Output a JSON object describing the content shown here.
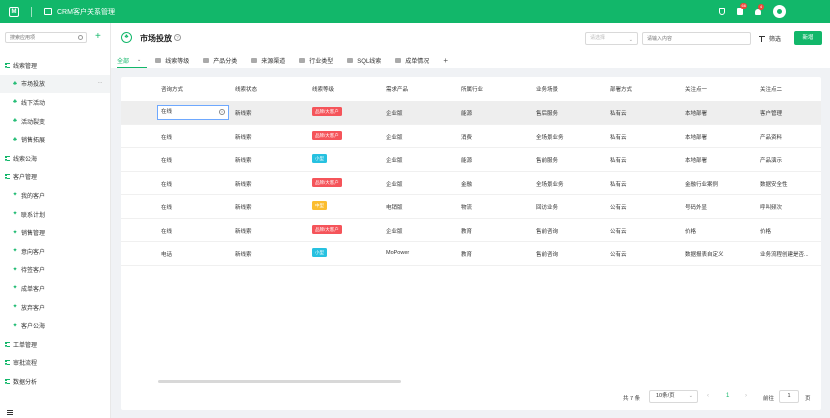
{
  "header": {
    "app_title": "CRM客户关系管理",
    "notif_doc_badge": "66",
    "notif_bell_badge": "4"
  },
  "sidebar": {
    "search_placeholder": "搜索应用项",
    "add_symbol": "+",
    "groups": [
      {
        "label": "线索管理",
        "type": "group"
      },
      {
        "label": "市场投放",
        "type": "child",
        "active": true
      },
      {
        "label": "线下活动",
        "type": "child"
      },
      {
        "label": "活动裂变",
        "type": "child"
      },
      {
        "label": "销售拓展",
        "type": "child"
      },
      {
        "label": "线索公海",
        "type": "group"
      },
      {
        "label": "客户管理",
        "type": "group"
      },
      {
        "label": "我的客户",
        "type": "child"
      },
      {
        "label": "联系计划",
        "type": "child"
      },
      {
        "label": "销售管理",
        "type": "child"
      },
      {
        "label": "意向客户",
        "type": "child"
      },
      {
        "label": "待签客户",
        "type": "child"
      },
      {
        "label": "成单客户",
        "type": "child"
      },
      {
        "label": "放弃客户",
        "type": "child"
      },
      {
        "label": "客户公海",
        "type": "child"
      },
      {
        "label": "工单管理",
        "type": "group"
      },
      {
        "label": "审批流程",
        "type": "group"
      },
      {
        "label": "数据分析",
        "type": "group"
      }
    ]
  },
  "page": {
    "title": "市场投放",
    "select_placeholder": "请选择",
    "keyword_placeholder": "请输入内容",
    "filter_label": "筛选",
    "new_button": "新增",
    "tabs": [
      "全部",
      "线索等级",
      "产品分类",
      "来源渠道",
      "行业类型",
      "SQL线索",
      "成单情况"
    ],
    "tab_add": "+"
  },
  "table": {
    "columns": [
      "咨询方式",
      "线索状态",
      "线索等级",
      "需求产品",
      "所属行业",
      "业务场景",
      "部署方式",
      "关注点一",
      "关注点二"
    ],
    "rows": [
      [
        "在线",
        "新线索",
        "品牌/大客户",
        "企业版",
        "能源",
        "售后服务",
        "私有云",
        "本地部署",
        "客户管理"
      ],
      [
        "在线",
        "新线索",
        "品牌/大客户",
        "企业版",
        "消费",
        "全场景业务",
        "私有云",
        "本地部署",
        "产品资料"
      ],
      [
        "在线",
        "新线索",
        "小型",
        "企业版",
        "能源",
        "售前服务",
        "私有云",
        "本地部署",
        "产品演示"
      ],
      [
        "在线",
        "新线索",
        "品牌/大客户",
        "企业版",
        "金融",
        "全场景业务",
        "私有云",
        "金融行业案例",
        "数据安全性"
      ],
      [
        "在线",
        "新线索",
        "中型",
        "电销版",
        "物流",
        "回访业务",
        "公有云",
        "号码外显",
        "呼叫频次"
      ],
      [
        "在线",
        "新线索",
        "品牌/大客户",
        "企业版",
        "教育",
        "售前咨询",
        "公有云",
        "价格",
        "价格"
      ],
      [
        "电话",
        "新线索",
        "小型",
        "MoPower",
        "教育",
        "售前咨询",
        "公有云",
        "数据报表自定义",
        "业务流程创建是否..."
      ]
    ],
    "tag_colors": {
      "品牌/大客户": "#f5545a",
      "小型": "#27c1e0",
      "中型": "#fbbd30"
    }
  },
  "pager": {
    "total": "共 7 条",
    "page_size": "10条/页",
    "prev": "‹",
    "current": "1",
    "next": "›",
    "goto_label": "前往",
    "goto_value": "1",
    "page_unit": "页"
  }
}
